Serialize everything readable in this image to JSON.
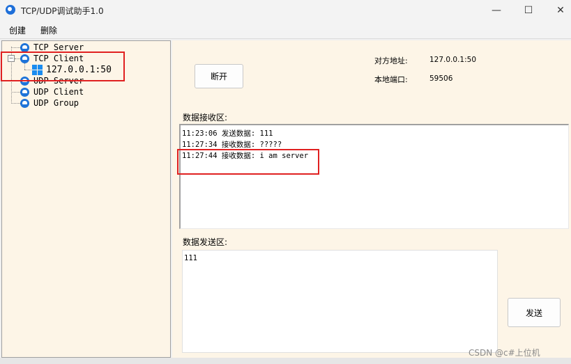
{
  "window": {
    "title": "TCP/UDP调试助手1.0",
    "minimize": "—",
    "maximize": "☐",
    "close": "✕"
  },
  "menu": {
    "items": [
      "创建",
      "删除"
    ]
  },
  "tree": {
    "nodes": [
      {
        "label": "TCP Server",
        "icon": "network-icon"
      },
      {
        "label": "TCP Client",
        "icon": "network-icon",
        "expanded": true
      },
      {
        "label": "127.0.0.1:50",
        "icon": "windows-icon"
      },
      {
        "label": "UDP Server",
        "icon": "network-icon"
      },
      {
        "label": "UDP Client",
        "icon": "network-icon"
      },
      {
        "label": "UDP Group",
        "icon": "network-icon"
      }
    ]
  },
  "connection": {
    "disconnect_label": "断开",
    "remote_addr_label": "对方地址:",
    "remote_addr_value": "127.0.0.1:50",
    "local_port_label": "本地端口:",
    "local_port_value": "59506"
  },
  "receive": {
    "label": "数据接收区:",
    "lines": [
      "11:23:06 发送数据: 111",
      "11:27:34 接收数据: ?????",
      "11:27:44 接收数据: i am server"
    ]
  },
  "send": {
    "label": "数据发送区:",
    "value": "111",
    "button_label": "发送"
  },
  "colors": {
    "panel_bg": "#fdf5e7",
    "highlight": "#e02020",
    "icon_blue": "#1e73d8"
  },
  "watermark": "CSDN @c#上位机"
}
